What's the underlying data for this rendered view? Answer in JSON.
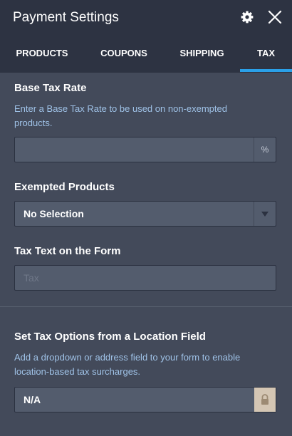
{
  "header": {
    "title": "Payment Settings",
    "settings_icon": "gear-icon",
    "close_icon": "close-icon"
  },
  "tabs": [
    {
      "label": "PRODUCTS",
      "active": false
    },
    {
      "label": "COUPONS",
      "active": false
    },
    {
      "label": "SHIPPING",
      "active": false
    },
    {
      "label": "TAX",
      "active": true
    }
  ],
  "tax": {
    "base_rate": {
      "label": "Base Tax Rate",
      "help": "Enter a Base Tax Rate to be used on non-exempted products.",
      "value": "",
      "placeholder": "",
      "suffix": "%"
    },
    "exempted": {
      "label": "Exempted Products",
      "selected": "No Selection"
    },
    "tax_text": {
      "label": "Tax Text on the Form",
      "value": "",
      "placeholder": "Tax"
    },
    "location": {
      "label": "Set Tax Options from a Location Field",
      "help": "Add a dropdown or address field to your form to enable location-based tax surcharges.",
      "value": "N/A"
    }
  },
  "colors": {
    "background": "#434a5a",
    "header": "#2d3342",
    "accent": "#2aa0e8",
    "help_text": "#9fc2e7",
    "field": "#535c6d",
    "lock": "#d4c6b4"
  }
}
